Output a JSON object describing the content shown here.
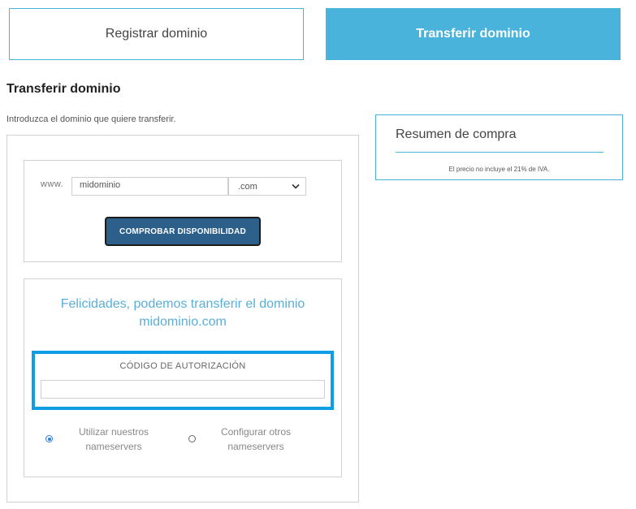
{
  "tabs": {
    "register": "Registrar dominio",
    "transfer": "Transferir dominio"
  },
  "page": {
    "title": "Transferir dominio",
    "intro": "Introduzca el dominio que quiere transferir."
  },
  "search": {
    "prefix": "www.",
    "domain_value": "midominio",
    "tld_selected": ".com",
    "check_button": "COMPROBAR DISPONIBILIDAD"
  },
  "result": {
    "message_line1": "Felicidades, podemos transferir el dominio",
    "message_line2": "midominio.com",
    "auth_label": "CÓDIGO DE AUTORIZACIÓN",
    "auth_value": "",
    "ns_own_line1": "Utilizar nuestros",
    "ns_own_line2": "nameservers",
    "ns_other_line1": "Configurar otros",
    "ns_other_line2": "nameservers",
    "ns_selected": "own"
  },
  "summary": {
    "title": "Resumen de compra",
    "note": "El precio no incluye el 21% de IVA."
  },
  "colors": {
    "accent": "#4ab3db",
    "button": "#2d5f8b",
    "highlight": "#0f9ee4"
  },
  "icons": {
    "tld_dropdown": "chevron-down-icon"
  }
}
